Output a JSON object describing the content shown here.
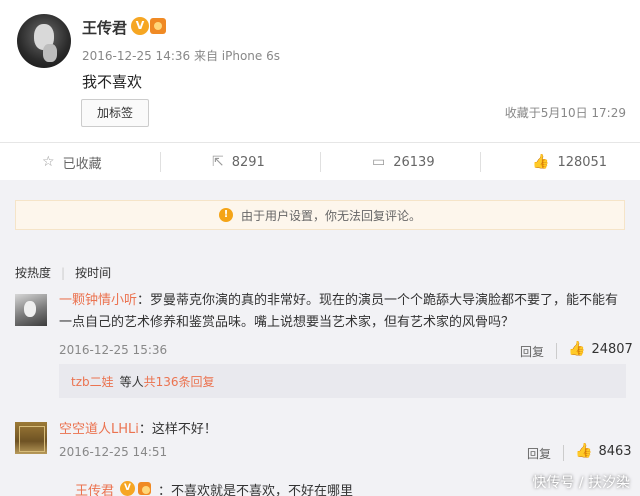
{
  "post": {
    "author": "王传君",
    "meta": "2016-12-25 14:36 来自 iPhone 6s",
    "text": "我不喜欢",
    "tag_button": "加标签",
    "favorited_time": "收藏于5月10日 17:29"
  },
  "actions": {
    "favorite": "已收藏",
    "repost_count": "8291",
    "comment_count": "26139",
    "like_count": "128051"
  },
  "notice": "由于用户设置，你无法回复评论。",
  "sort": {
    "hot": "按热度",
    "time": "按时间"
  },
  "comments": [
    {
      "user": "一颗钟情小听",
      "text_line1": "：罗曼蒂克你演的真的非常好。现在的演员一个个跪舔大导演脸都不要了，能不能有",
      "text_line2": "一点自己的艺术修养和鉴赏品味。嘴上说想要当艺术家，但有艺术家的风骨吗？",
      "time": "2016-12-25 15:36",
      "reply_label": "回复",
      "likes": "24807"
    },
    {
      "user": "空空道人LHLi",
      "text": "：这样不好！",
      "time": "2016-12-25 14:51",
      "reply_label": "回复",
      "likes": "8463"
    }
  ],
  "subreplies": {
    "user": "tzb二娃",
    "middle": "等人",
    "count": "共136条回复"
  },
  "author_reply": {
    "user": "王传君",
    "text": "：不喜欢就是不喜欢，不好在哪里"
  },
  "watermark": "快传号 / 扶汐染"
}
